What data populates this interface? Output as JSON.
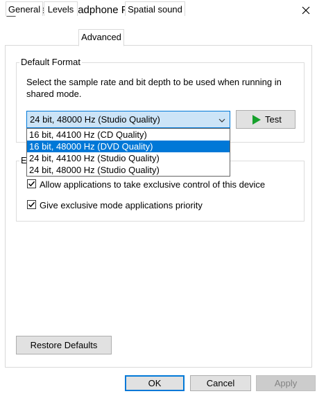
{
  "window": {
    "title": "Speaker/Headphone Properties"
  },
  "tabs": [
    {
      "label": "General"
    },
    {
      "label": "Levels"
    },
    {
      "label": "Advanced"
    },
    {
      "label": "Spatial sound"
    }
  ],
  "default_format": {
    "legend": "Default Format",
    "description": "Select the sample rate and bit depth to be used when running in shared mode.",
    "selected": "24 bit, 48000 Hz (Studio Quality)",
    "options": [
      "16 bit, 44100 Hz (CD Quality)",
      "16 bit, 48000 Hz (DVD Quality)",
      "24 bit, 44100 Hz (Studio Quality)",
      "24 bit, 48000 Hz (Studio Quality)"
    ],
    "test_label": "Test"
  },
  "exclusive_mode": {
    "legend_visible": "E",
    "allow_label": "Allow applications to take exclusive control of this device",
    "allow_checked": true,
    "priority_label": "Give exclusive mode applications priority",
    "priority_checked": true
  },
  "buttons": {
    "restore": "Restore Defaults",
    "ok": "OK",
    "cancel": "Cancel",
    "apply": "Apply"
  },
  "colors": {
    "accent": "#0078d7",
    "combo_bg": "#cce4f7",
    "play_green": "#16a12c"
  }
}
